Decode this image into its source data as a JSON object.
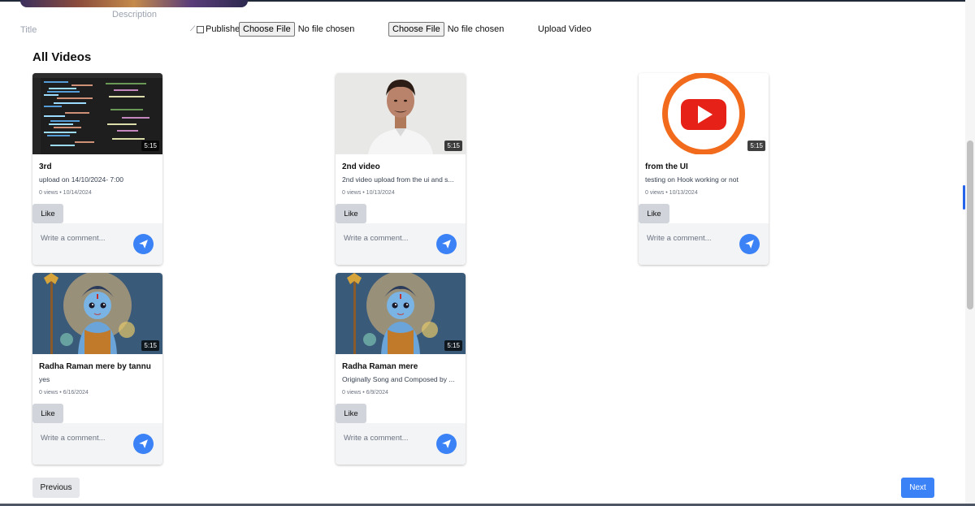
{
  "upload_form": {
    "description_placeholder": "Description",
    "title_placeholder": "Title",
    "published_label": "Published",
    "thumbnail_file": {
      "button_label": "Choose File",
      "status": "No file chosen"
    },
    "video_file": {
      "button_label": "Choose File",
      "status": "No file chosen"
    },
    "upload_label": "Upload Video"
  },
  "section_title": "All Videos",
  "videos": [
    {
      "title": "3rd",
      "description": "upload on 14/10/2024- 7:00",
      "meta": "0 views • 10/14/2024",
      "duration": "5:15",
      "like_label": "Like",
      "comment_placeholder": "Write a comment..."
    },
    {
      "title": "2nd video",
      "description": "2nd video upload from the ui and s...",
      "meta": "0 views • 10/13/2024",
      "duration": "5:15",
      "like_label": "Like",
      "comment_placeholder": "Write a comment..."
    },
    {
      "title": "from the UI",
      "description": "testing on Hook working or not",
      "meta": "0 views • 10/13/2024",
      "duration": "5:15",
      "like_label": "Like",
      "comment_placeholder": "Write a comment..."
    },
    {
      "title": "Radha Raman mere by tannu",
      "description": "yes",
      "meta": "0 views • 6/16/2024",
      "duration": "5:15",
      "like_label": "Like",
      "comment_placeholder": "Write a comment..."
    },
    {
      "title": "Radha Raman mere",
      "description": "Originally Song and Composed by ...",
      "meta": "0 views • 6/9/2024",
      "duration": "5:15",
      "like_label": "Like",
      "comment_placeholder": "Write a comment..."
    }
  ],
  "pagination": {
    "previous_label": "Previous",
    "next_label": "Next"
  },
  "colors": {
    "accent": "#3b82f6",
    "like_bg": "#d1d5db",
    "comment_bg": "#f3f4f6"
  }
}
